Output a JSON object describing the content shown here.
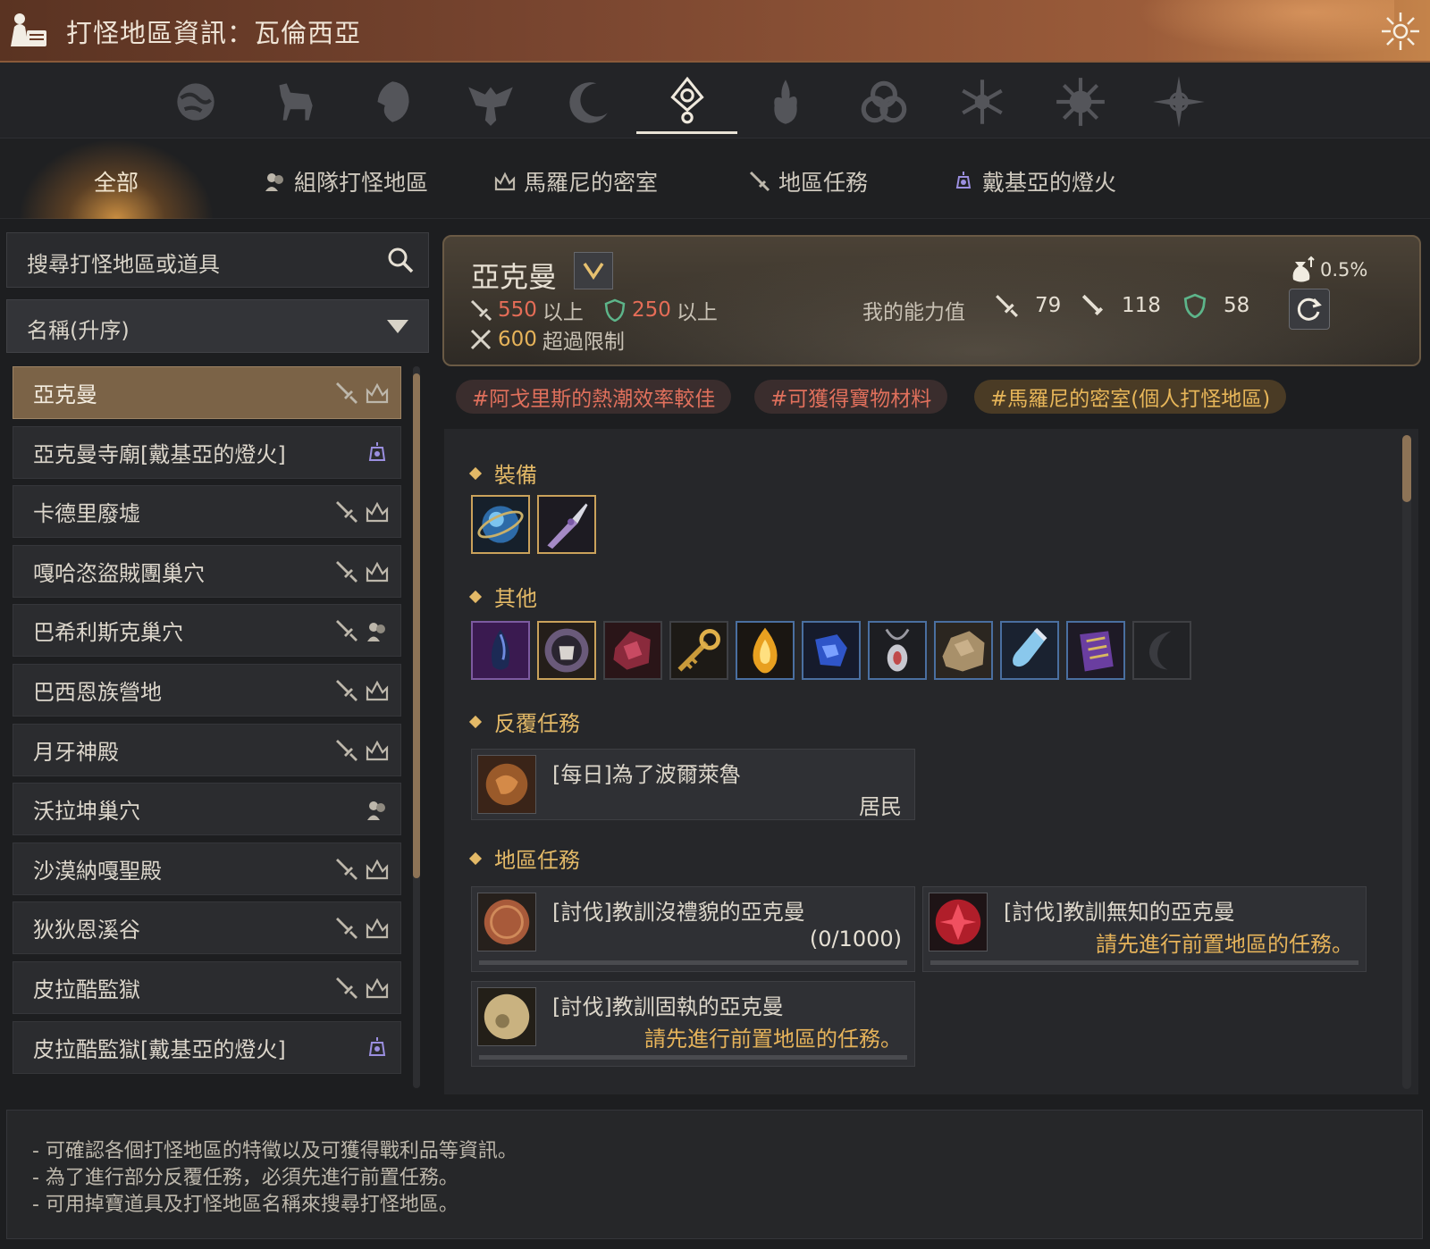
{
  "window": {
    "title": "打怪地區資訊：瓦倫西亞",
    "title_icon": "npc-book-icon",
    "corner_icon": "sun-emblem-icon"
  },
  "region_tabs": [
    {
      "icon": "globe-region-icon",
      "active": false
    },
    {
      "icon": "horse-region-icon",
      "active": false
    },
    {
      "icon": "lion-region-icon",
      "active": false
    },
    {
      "icon": "eagle-crest-region-icon",
      "active": false
    },
    {
      "icon": "crescent-moon-region-icon",
      "active": false
    },
    {
      "icon": "sun-eye-region-icon",
      "active": true
    },
    {
      "icon": "flame-region-icon",
      "active": false
    },
    {
      "icon": "triquetra-region-icon",
      "active": false
    },
    {
      "icon": "snowflake-region-icon",
      "active": false
    },
    {
      "icon": "radiant-sun-region-icon",
      "active": false
    },
    {
      "icon": "compass-star-region-icon",
      "active": false
    }
  ],
  "category_tabs": [
    {
      "label": "全部",
      "icon": "",
      "active": true
    },
    {
      "label": "組隊打怪地區",
      "icon": "party-icon"
    },
    {
      "label": "馬羅尼的密室",
      "icon": "crown-icon"
    },
    {
      "label": "地區任務",
      "icon": "sword-icon"
    },
    {
      "label": "戴基亞的燈火",
      "icon": "lantern-icon"
    }
  ],
  "search": {
    "placeholder": "搜尋打怪地區或道具"
  },
  "sort": {
    "value": "名稱(升序)"
  },
  "zones": [
    {
      "name": "亞克曼",
      "icons": [
        "sword-icon",
        "crown-icon"
      ],
      "selected": true
    },
    {
      "name": "亞克曼寺廟[戴基亞的燈火]",
      "icons": [
        "lantern-icon"
      ]
    },
    {
      "name": "卡德里廢墟",
      "icons": [
        "sword-icon",
        "crown-icon"
      ]
    },
    {
      "name": "嘎哈恣盜賊團巢穴",
      "icons": [
        "sword-icon",
        "crown-icon"
      ]
    },
    {
      "name": "巴希利斯克巢穴",
      "icons": [
        "sword-icon",
        "party-icon"
      ]
    },
    {
      "name": "巴西恩族營地",
      "icons": [
        "sword-icon",
        "crown-icon"
      ]
    },
    {
      "name": "月牙神殿",
      "icons": [
        "sword-icon",
        "crown-icon"
      ]
    },
    {
      "name": "沃拉坤巢穴",
      "icons": [
        "party-icon"
      ]
    },
    {
      "name": "沙漠納嘎聖殿",
      "icons": [
        "sword-icon",
        "crown-icon"
      ]
    },
    {
      "name": "狄狄恩溪谷",
      "icons": [
        "sword-icon",
        "crown-icon"
      ]
    },
    {
      "name": "皮拉酷監獄",
      "icons": [
        "sword-icon",
        "crown-icon"
      ]
    },
    {
      "name": "皮拉酷監獄[戴基亞的燈火]",
      "icons": [
        "lantern-icon"
      ]
    }
  ],
  "detail": {
    "zone_name": "亞克曼",
    "drop_rate": "0.5%",
    "requirements": {
      "ap": {
        "value": "550",
        "suffix": "以上"
      },
      "dp": {
        "value": "250",
        "suffix": "以上"
      },
      "cap": {
        "value": "600",
        "suffix": "超過限制"
      }
    },
    "my_stats_label": "我的能力值",
    "my_stats": {
      "ap": "79",
      "awaken_ap": "118",
      "dp": "58"
    },
    "tags": [
      {
        "text": "#阿戈里斯的熱潮效率較佳",
        "style": "red"
      },
      {
        "text": "#可獲得寶物材料",
        "style": "red"
      },
      {
        "text": "#馬羅尼的密室(個人打怪地區)",
        "style": "gold"
      }
    ],
    "sections": {
      "equipment": "裝備",
      "other": "其他",
      "repeat_quests": "反覆任務",
      "area_quests": "地區任務"
    },
    "equipment_items": [
      "blue-orb-icon",
      "dagger-icon"
    ],
    "other_items": [
      "dark-crystal-icon",
      "skull-medallion-icon",
      "red-ore-icon",
      "golden-key-icon",
      "fire-gem-icon",
      "blue-relic-icon",
      "amulet-icon",
      "stone-ore-icon",
      "potion-icon",
      "purple-scroll-icon",
      "black-horn-icon"
    ],
    "repeat_quest": {
      "title": "[每日]為了波爾萊魯",
      "sub": "居民"
    },
    "area_quests": [
      {
        "title": "[討伐]教訓沒禮貌的亞克曼",
        "status": "(0/1000)",
        "status_style": "count",
        "icon": "copper-coin-icon"
      },
      {
        "title": "[討伐]教訓無知的亞克曼",
        "status": "請先進行前置地區的任務。",
        "status_style": "gold",
        "icon": "red-gem-icon"
      },
      {
        "title": "[討伐]教訓固執的亞克曼",
        "status": "請先進行前置地區的任務。",
        "status_style": "gold",
        "icon": "gold-coin-icon"
      }
    ]
  },
  "footer": {
    "tips": [
      "- 可確認各個打怪地區的特徵以及可獲得戰利品等資訊。",
      "- 為了進行部分反覆任務，必須先進行前置任務。",
      "- 可用掉寶道具及打怪地區名稱來搜尋打怪地區。"
    ]
  },
  "colors": {
    "accent_gold": "#e3b967",
    "requirement_red": "#e56d57",
    "selected_item": "#7b6347"
  }
}
